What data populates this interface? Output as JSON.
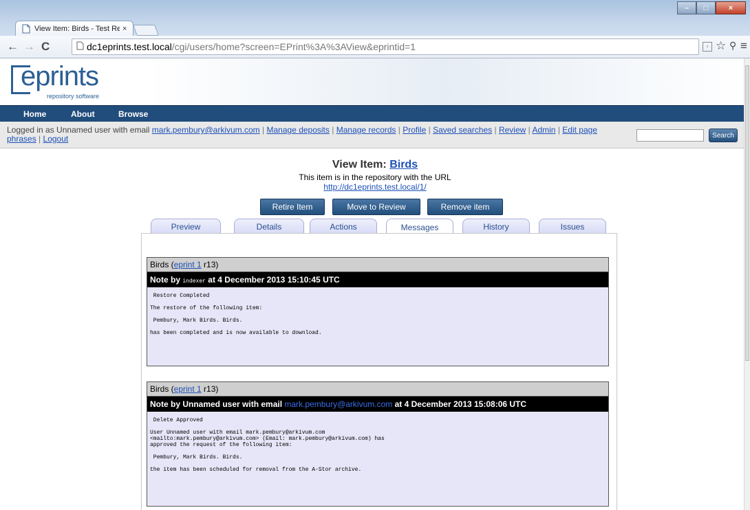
{
  "browser": {
    "tab_title": "View Item: Birds - Test Rep",
    "tab_close": "×",
    "url_host": "dc1eprints.test.local",
    "url_path": "/cgi/users/home?screen=EPrint%3A%3AView&eprintid=1",
    "back_icon": "←",
    "forward_icon": "→",
    "reload_icon": "C",
    "menu_icon": "≡",
    "star_icon": "☆",
    "win_min": "–",
    "win_max": "□",
    "win_close": "×"
  },
  "site": {
    "logo_text": "eprints",
    "logo_sub": "repository software",
    "menu": [
      "Home",
      "About",
      "Browse"
    ],
    "logged_in_prefix": "Logged in as Unnamed user with email ",
    "user_email": "mark.pembury@arkivum.com",
    "user_links": [
      "Manage deposits",
      "Manage records",
      "Profile",
      "Saved searches",
      "Review",
      "Admin",
      "Edit page phrases",
      "Logout"
    ],
    "search_button": "Search"
  },
  "main": {
    "title_prefix": "View Item: ",
    "title_link": "Birds",
    "description": "This item is in the repository with the URL",
    "item_url": "http://dc1eprints.test.local/1/",
    "buttons": [
      "Retire Item",
      "Move to Review",
      "Remove item"
    ],
    "tabs": [
      "Preview",
      "Details",
      "Actions",
      "Messages",
      "History",
      "Issues"
    ],
    "active_tab": "Messages"
  },
  "messages": [
    {
      "item_title": "Birds (",
      "eprint_link": "eprint 1",
      "revision": " r13)",
      "note_prefix": "Note by ",
      "author": "indexer",
      "timestamp": " at 4 December 2013 15:10:45 UTC",
      "body": [
        " Restore Completed",
        "",
        "The restore of the following item:",
        "",
        " Pembury, Mark Birds. Birds.",
        "",
        "has been completed and is now available to download."
      ]
    },
    {
      "item_title": "Birds (",
      "eprint_link": "eprint 1",
      "revision": " r13)",
      "note_prefix": "Note by Unnamed user with email ",
      "author_email": "mark.pembury@arkivum.com",
      "timestamp": " at 4 December 2013 15:08:06 UTC",
      "body": [
        " Delete Approved",
        "",
        "User Unnamed user with email mark.pembury@arkivum.com",
        "<mailto:mark.pembury@arkivum.com> (Email: mark.pembury@arkivum.com) has",
        "approved the request of the following item:",
        "",
        " Pembury, Mark Birds. Birds.",
        "",
        "the item has been scheduled for removal from the A-Stor archive."
      ]
    }
  ],
  "colors": {
    "menubar": "#214d7c",
    "link": "#1c4fb8",
    "button": "#234f7d",
    "message_bg": "#e6e6f8"
  }
}
